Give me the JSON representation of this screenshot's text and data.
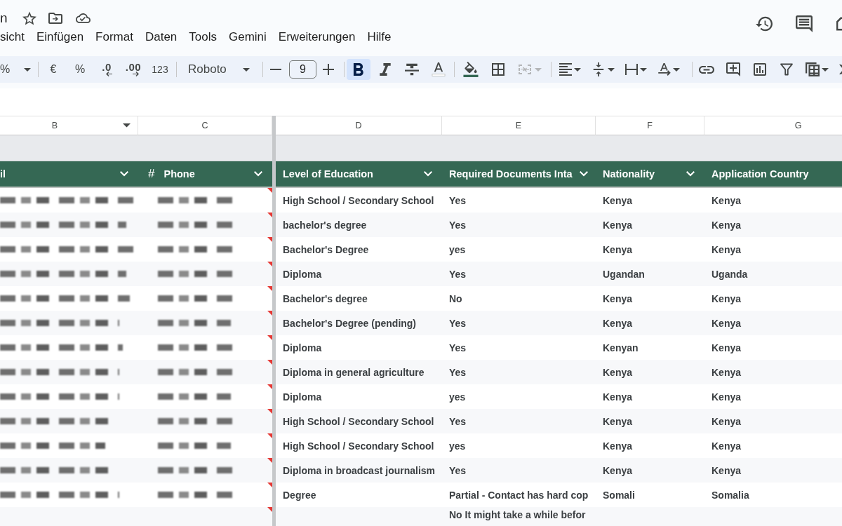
{
  "document": {
    "title": "n"
  },
  "menu": [
    "sicht",
    "Einfügen",
    "Format",
    "Daten",
    "Tools",
    "Gemini",
    "Erweiterungen",
    "Hilfe"
  ],
  "toolbar": {
    "zoom": "%",
    "currency": "€",
    "percent": "%",
    "decrease_decimals": ".0",
    "increase_decimals": ".00",
    "number_format": "123",
    "font": "Roboto",
    "font_size": "9",
    "format": [
      {
        "kind": "bold",
        "selected": true
      },
      {
        "kind": "italic",
        "selected": false
      },
      {
        "kind": "strikethrough",
        "selected": false
      }
    ],
    "merge": {
      "disabled": true
    }
  },
  "table": {
    "columns": [
      {
        "letter": "B",
        "letter_menu": true,
        "header": "il",
        "header_menu": true
      },
      {
        "letter": "C",
        "letter_menu": false,
        "type_mark": "#",
        "header": "Phone",
        "header_menu": true
      },
      {
        "letter": "D",
        "letter_menu": false,
        "header": "Level of Education",
        "header_menu": true
      },
      {
        "letter": "E",
        "letter_menu": false,
        "header": "Required Documents Inta",
        "header_menu": true
      },
      {
        "letter": "F",
        "letter_menu": false,
        "header": "Nationality",
        "header_menu": true
      },
      {
        "letter": "G",
        "letter_menu": false,
        "header": "Application Country",
        "header_menu": false
      }
    ],
    "rows": [
      {
        "redacted": true,
        "note": true,
        "education": "High School / Secondary School",
        "documents": "Yes",
        "nationality": "Kenya",
        "country": "Kenya"
      },
      {
        "redacted": true,
        "note": true,
        "education": "bachelor's degree",
        "documents": "Yes",
        "nationality": "Kenya",
        "country": "Kenya"
      },
      {
        "redacted": true,
        "note": true,
        "education": "Bachelor's Degree",
        "documents": "yes",
        "nationality": "Kenya",
        "country": "Kenya"
      },
      {
        "redacted": true,
        "note": true,
        "education": "Diploma",
        "documents": "Yes",
        "nationality": "Ugandan",
        "country": "Uganda"
      },
      {
        "redacted": true,
        "note": true,
        "education": "Bachelor's degree",
        "documents": "No",
        "nationality": "Kenya",
        "country": "Kenya"
      },
      {
        "redacted": true,
        "note": true,
        "education": "Bachelor's Degree (pending)",
        "documents": "Yes",
        "nationality": "Kenya",
        "country": "Kenya"
      },
      {
        "redacted": true,
        "note": true,
        "education": "Diploma",
        "documents": "Yes",
        "nationality": "Kenyan",
        "country": "Kenya"
      },
      {
        "redacted": true,
        "note": true,
        "education": "Diploma in general agriculture",
        "documents": "Yes",
        "nationality": "Kenya",
        "country": "Kenya"
      },
      {
        "redacted": true,
        "note": true,
        "education": "Diploma",
        "documents": "yes",
        "nationality": "Kenya",
        "country": "Kenya"
      },
      {
        "redacted": true,
        "note": true,
        "education": "High School / Secondary School",
        "documents": "Yes",
        "nationality": "Kenya",
        "country": "Kenya"
      },
      {
        "redacted": true,
        "note": true,
        "education": "High School / Secondary School",
        "documents": "yes",
        "nationality": "Kenya",
        "country": "Kenya"
      },
      {
        "redacted": true,
        "note": true,
        "education": "Diploma in broadcast journalism",
        "documents": "Yes",
        "nationality": "Kenya",
        "country": "Kenya"
      },
      {
        "redacted": true,
        "note": true,
        "education": "Degree",
        "documents": "Partial - Contact has hard cop",
        "nationality": "Somali",
        "country": "Somalia"
      },
      {
        "redacted": false,
        "note": true,
        "documents": "No It might take a while befor"
      }
    ]
  }
}
